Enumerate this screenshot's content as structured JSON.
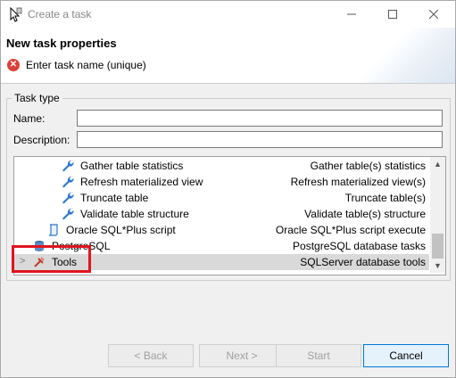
{
  "window": {
    "title": "Create a task"
  },
  "header": {
    "title": "New task properties",
    "message": "Enter task name (unique)"
  },
  "task_type": {
    "group_label": "Task type",
    "name_label": "Name:",
    "name_value": "",
    "description_label": "Description:",
    "description_value": ""
  },
  "tree": {
    "rows": [
      {
        "name": "Gather table statistics",
        "desc": "Gather table(s) statistics",
        "icon": "wrench-icon"
      },
      {
        "name": "Refresh materialized view",
        "desc": "Refresh materialized view(s)",
        "icon": "wrench-icon"
      },
      {
        "name": "Truncate table",
        "desc": "Truncate table(s)",
        "icon": "wrench-icon"
      },
      {
        "name": "Validate table structure",
        "desc": "Validate table(s) structure",
        "icon": "wrench-icon"
      },
      {
        "name": "Oracle SQL*Plus script",
        "desc": "Oracle SQL*Plus script execute",
        "icon": "script-icon"
      },
      {
        "name": "PostgreSQL",
        "desc": "PostgreSQL database tasks",
        "icon": "database-icon"
      },
      {
        "name": "Tools",
        "desc": "SQLServer database tools",
        "icon": "tools-icon"
      }
    ]
  },
  "buttons": {
    "back": "< Back",
    "next": "Next >",
    "start": "Start",
    "cancel": "Cancel"
  },
  "colors": {
    "accent": "#0078d7",
    "error": "#d9423b",
    "highlight": "#e0141e"
  }
}
